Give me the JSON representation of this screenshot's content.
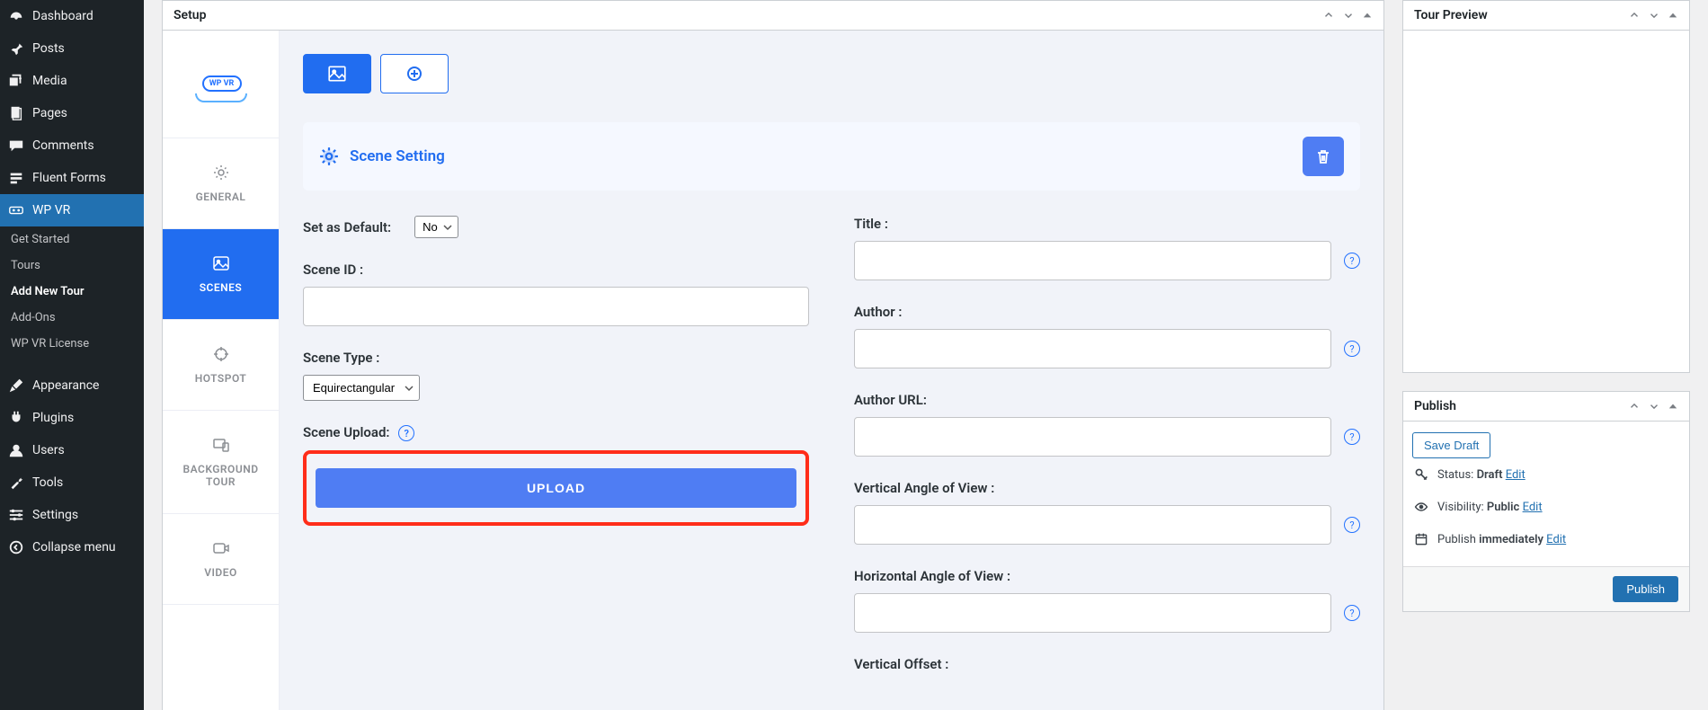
{
  "sidebar": {
    "items": [
      {
        "label": "Dashboard"
      },
      {
        "label": "Posts"
      },
      {
        "label": "Media"
      },
      {
        "label": "Pages"
      },
      {
        "label": "Comments"
      },
      {
        "label": "Fluent Forms"
      },
      {
        "label": "WP VR"
      },
      {
        "label": "Appearance"
      },
      {
        "label": "Plugins"
      },
      {
        "label": "Users"
      },
      {
        "label": "Tools"
      },
      {
        "label": "Settings"
      },
      {
        "label": "Collapse menu"
      }
    ],
    "wvpr_sub": [
      {
        "label": "Get Started"
      },
      {
        "label": "Tours"
      },
      {
        "label": "Add New Tour"
      },
      {
        "label": "Add-Ons"
      },
      {
        "label": "WP VR License"
      }
    ]
  },
  "panels": {
    "setup_title": "Setup",
    "preview_title": "Tour Preview",
    "publish_title": "Publish"
  },
  "logo_text": "WP VR",
  "vtabs": {
    "general": "GENERAL",
    "scenes": "SCENES",
    "hotspot": "HOTSPOT",
    "background_tour": "BACKGROUND TOUR",
    "video": "VIDEO"
  },
  "scene": {
    "header": "Scene Setting",
    "default_label": "Set as Default:",
    "default_value": "No",
    "scene_id_label": "Scene ID :",
    "scene_id_value": "",
    "scene_type_label": "Scene Type :",
    "scene_type_value": "Equirectangular",
    "scene_upload_label": "Scene Upload:",
    "upload_button": "UPLOAD",
    "title_label": "Title :",
    "title_value": "",
    "author_label": "Author :",
    "author_value": "",
    "author_url_label": "Author URL:",
    "author_url_value": "",
    "vaov_label": "Vertical Angle of View :",
    "vaov_value": "",
    "haov_label": "Horizontal Angle of View :",
    "haov_value": "",
    "voffset_label": "Vertical Offset :"
  },
  "publish": {
    "save_draft": "Save Draft",
    "status_prefix": "Status:",
    "status_value": "Draft",
    "visibility_prefix": "Visibility:",
    "visibility_value": "Public",
    "schedule_prefix": "Publish",
    "schedule_value": "immediately",
    "edit": "Edit",
    "publish_button": "Publish"
  }
}
